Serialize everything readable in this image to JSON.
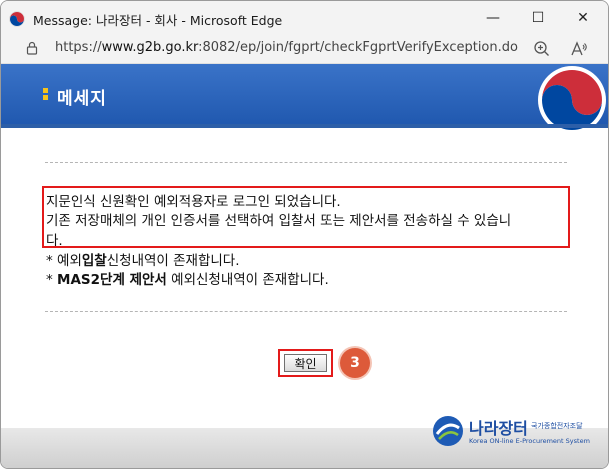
{
  "window": {
    "title": "Message: 나라장터 - 회사 - Microsoft Edge",
    "minimize": "—",
    "maximize": "☐",
    "close": "✕"
  },
  "address": {
    "url_scheme": "https://",
    "url_domain": "www.g2b.go.kr",
    "url_rest": ":8082/ep/join/fgprt/checkFgprtVerifyException.do"
  },
  "banner": {
    "title": "메세지"
  },
  "message": {
    "line1": "지문인식 신원확인 예외적용자로 로그인 되었습니다.",
    "line2": "기존 저장매체의 개인 인증서를 선택하여 입찰서 또는 제안서를 전송하실 수 있습니",
    "line3": "다.",
    "item1_prefix": "* 예외",
    "item1_bold": "입찰",
    "item1_suffix": "신청내역이 존재합니다.",
    "item2_prefix": "* ",
    "item2_bold": "MAS2단계 제안서",
    "item2_suffix": " 예외신청내역이 존재합니다."
  },
  "buttons": {
    "ok_label": "확인"
  },
  "annotation": {
    "step_number": "3"
  },
  "footer": {
    "logo_text": "나라장터",
    "logo_subtext": "국가종합전자조달",
    "logo_english": "Korea ON-line E-Procurement System"
  },
  "colors": {
    "highlight_red": "#e31a1a",
    "banner_blue": "#2a64bd",
    "step_badge": "#dd5a3a"
  }
}
